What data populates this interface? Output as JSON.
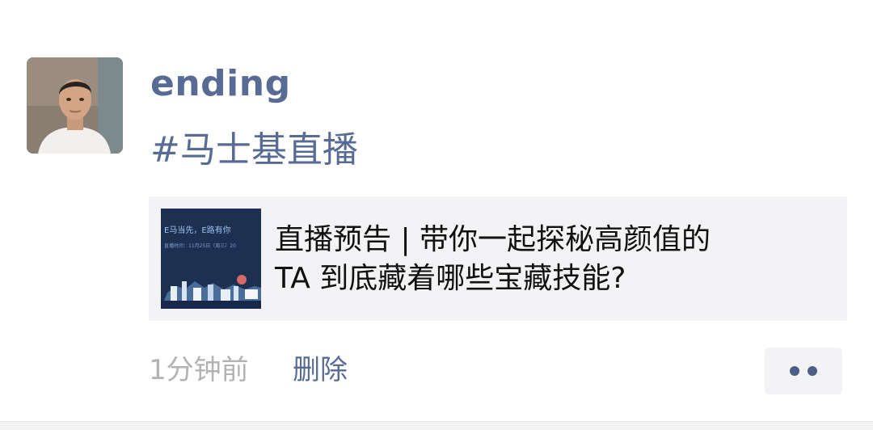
{
  "post": {
    "username": "ending",
    "hashtag": "#马士基直播",
    "link": {
      "title_line1": "直播预告 | 带你一起探秘高颜值的",
      "title_line2": "TA 到底藏着哪些宝藏技能?",
      "thumbnail_text_line1": "E马当先，E路有你",
      "thumbnail_text_line2": "直播时间：11月25日（周三）20"
    },
    "time": "1分钟前",
    "delete_label": "删除",
    "more_icon": "more-dots-icon"
  },
  "colors": {
    "name_link": "#576b95",
    "card_bg": "#f3f3f5",
    "meta_gray": "#b3b3b3"
  }
}
